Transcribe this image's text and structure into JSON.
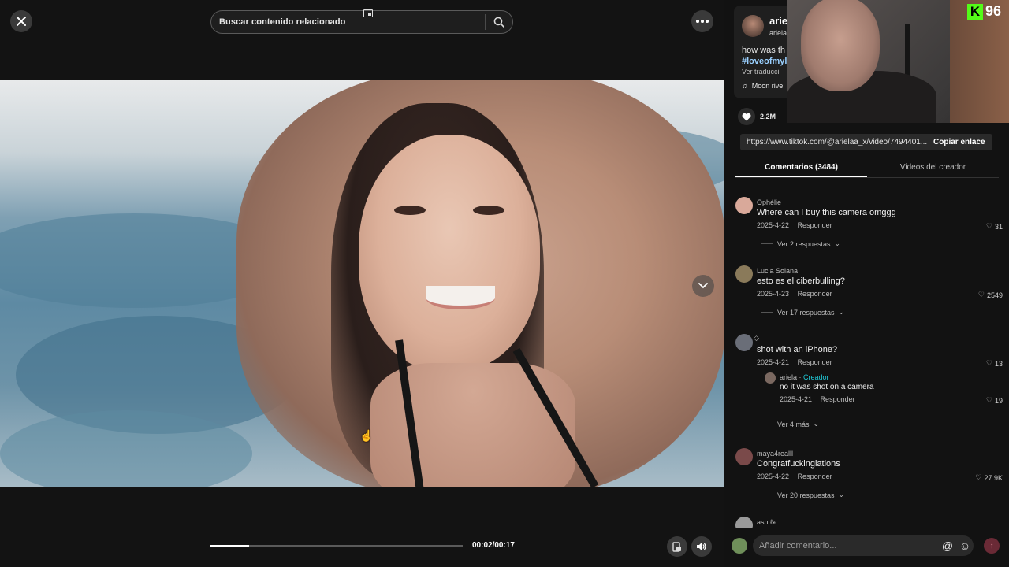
{
  "colors": {
    "background": "#121212",
    "accent_link": "#9ad0ff",
    "creator_tag": "#1fc8d6",
    "kick_green": "#53fc18"
  },
  "top_bar": {
    "close_icon": "close-icon",
    "search_placeholder": "Buscar contenido relacionado",
    "search_icon": "search-icon",
    "more_icon": "more-horizontal-icon"
  },
  "player": {
    "current_time": "00:02",
    "total_time": "00:17",
    "time_display": "00:02/00:17",
    "progress": 0.154
  },
  "post": {
    "author_name": "arie",
    "author_handle": "ariela",
    "description": "how was th",
    "hashtag": "#loveofmyl",
    "translate_label": "Ver traducci",
    "music": "Moon rive",
    "likes": "2.2M",
    "share_url": "https://www.tiktok.com/@arielaa_x/video/7494401...",
    "copy_label": "Copiar enlace"
  },
  "stream_overlay": {
    "badge_letter": "K",
    "badge_number": "96"
  },
  "tabs": [
    {
      "label": "Comentarios (3484)",
      "active": true
    },
    {
      "label": "Videos del creador",
      "active": false
    }
  ],
  "comments": [
    {
      "name": "Ophélie",
      "text": "Where can I buy this camera omggg",
      "date": "2025-4-22",
      "reply_label": "Responder",
      "likes": "31",
      "more": "Ver 2 respuestas",
      "avatar_color": "#d9a99a"
    },
    {
      "name": "Lucia Solana",
      "text": "esto es el ciberbulling?",
      "date": "2025-4-23",
      "reply_label": "Responder",
      "likes": "2549",
      "more": "Ver 17 respuestas",
      "avatar_color": "#8a7a5a"
    },
    {
      "name": "◇",
      "text": "shot with an iPhone?",
      "date": "2025-4-21",
      "reply_label": "Responder",
      "likes": "13",
      "more": "Ver 4 más",
      "avatar_color": "#6a6e78",
      "reply": {
        "name": "ariela",
        "creator_label": "Creador",
        "text": "no it was shot on a camera",
        "date": "2025-4-21",
        "reply_label": "Responder",
        "likes": "19"
      }
    },
    {
      "name": "maya4realll",
      "text": "Congratfuckinglations",
      "date": "2025-4-22",
      "reply_label": "Responder",
      "likes": "27.9K",
      "more": "Ver 20 respuestas",
      "avatar_color": "#7a4a4a"
    },
    {
      "name": "ash ℓ𝓮",
      "text": "",
      "date": "",
      "reply_label": "",
      "likes": "",
      "more": "",
      "avatar_color": "#9a9a9a"
    }
  ],
  "comment_input": {
    "placeholder": "Añadir comentario...",
    "at_icon": "@",
    "emoji_icon": "☺"
  }
}
